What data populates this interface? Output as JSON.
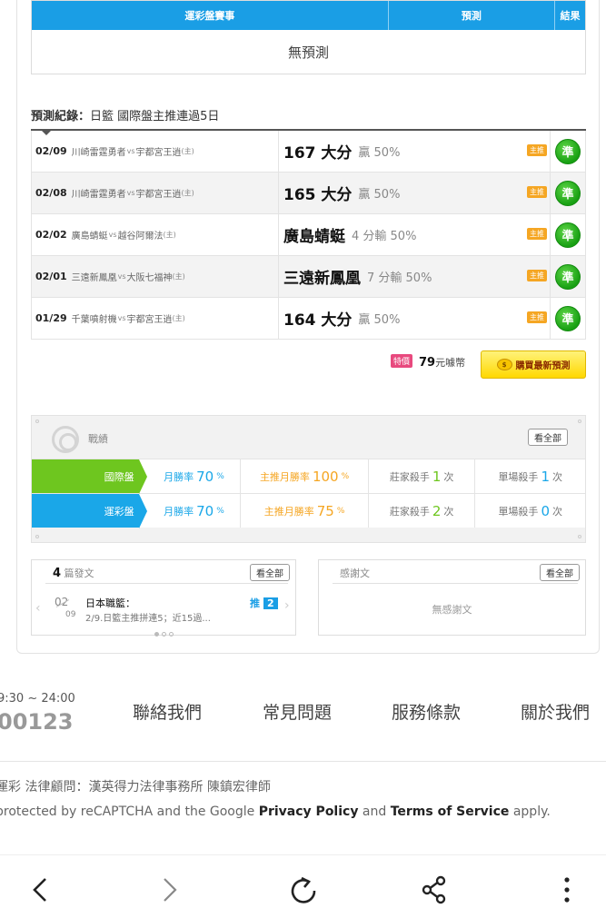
{
  "pred_table": {
    "headers": [
      "運彩盤賽事",
      "預測",
      "結果"
    ],
    "empty": "無預測"
  },
  "history": {
    "title_bold": "預測紀錄：",
    "title_rest": "日籃 國際盤主推連過5日",
    "rows": [
      {
        "date": "02/09",
        "away": "川崎雷霆勇者",
        "vs": "vs",
        "home": "宇都宮王逍",
        "home_mark": "(主)",
        "pick": "167 大分",
        "result": "贏 50%",
        "tag": "主推",
        "badge": "準"
      },
      {
        "date": "02/08",
        "away": "川崎雷霆勇者",
        "vs": "vs",
        "home": "宇都宮王逍",
        "home_mark": "(主)",
        "pick": "165 大分",
        "result": "贏 50%",
        "tag": "主推",
        "badge": "準"
      },
      {
        "date": "02/02",
        "away": "廣島蜻蜓",
        "vs": "vs",
        "home": "越谷阿爾法",
        "home_mark": "(主)",
        "pick": "廣島蜻蜓",
        "result": "4 分輸 50%",
        "tag": "主推",
        "badge": "準"
      },
      {
        "date": "02/01",
        "away": "三遠新鳳凰",
        "vs": "vs",
        "home": "大阪七福神",
        "home_mark": "(主)",
        "pick": "三遠新鳳凰",
        "result": "7 分輸 50%",
        "tag": "主推",
        "badge": "準"
      },
      {
        "date": "01/29",
        "away": "千葉噴射機",
        "vs": "vs",
        "home": "宇都宮王逍",
        "home_mark": "(主)",
        "pick": "164 大分",
        "result": "贏 50%",
        "tag": "主推",
        "badge": "準"
      }
    ]
  },
  "buy": {
    "special": "特價",
    "price": "79",
    "unit": "元噱幣",
    "button": "購買最新預測"
  },
  "record": {
    "title": "戰績",
    "see_all": "看全部",
    "rows": [
      {
        "label": "國際盤",
        "color": "#6ec61f",
        "month_label": "月勝率",
        "month_val": "70",
        "main_label": "主推月勝率",
        "main_val": "100",
        "pct": "%",
        "dealer_label": "莊家殺手",
        "dealer_val": "1",
        "single_label": "單場殺手",
        "single_val": "1",
        "times": "次"
      },
      {
        "label": "運彩盤",
        "color": "#1aa7e8",
        "month_label": "月勝率",
        "month_val": "70",
        "main_label": "主推月勝率",
        "main_val": "75",
        "pct": "%",
        "dealer_label": "莊家殺手",
        "dealer_val": "2",
        "single_label": "單場殺手",
        "single_val": "0",
        "times": "次"
      }
    ]
  },
  "posts": {
    "count": "4",
    "label": "篇發文",
    "see_all": "看全部",
    "item": {
      "day": "02",
      "month": "09",
      "title": "日本職籃：",
      "desc": "2/9.日籃主推拼連5；近15過...",
      "push_label": "推",
      "push_count": "2"
    }
  },
  "thanks": {
    "title": "感謝文",
    "see_all": "看全部",
    "empty": "無感謝文"
  },
  "footer": {
    "hours": "9:30 ~ 24:00",
    "phone": "00123",
    "links": [
      "聯絡我們",
      "常見問題",
      "服務條款",
      "關於我們"
    ],
    "legal": "運彩 法律顧問：漢英得力法律事務所 陳鎮宏律師",
    "recaptcha_pre": "protected by reCAPTCHA and the Google ",
    "privacy": "Privacy Policy",
    "and": " and ",
    "terms": "Terms of Service",
    "apply": " apply."
  },
  "browser": {
    "icons": [
      "back-icon",
      "forward-icon",
      "reload-icon",
      "share-icon",
      "more-icon"
    ]
  }
}
